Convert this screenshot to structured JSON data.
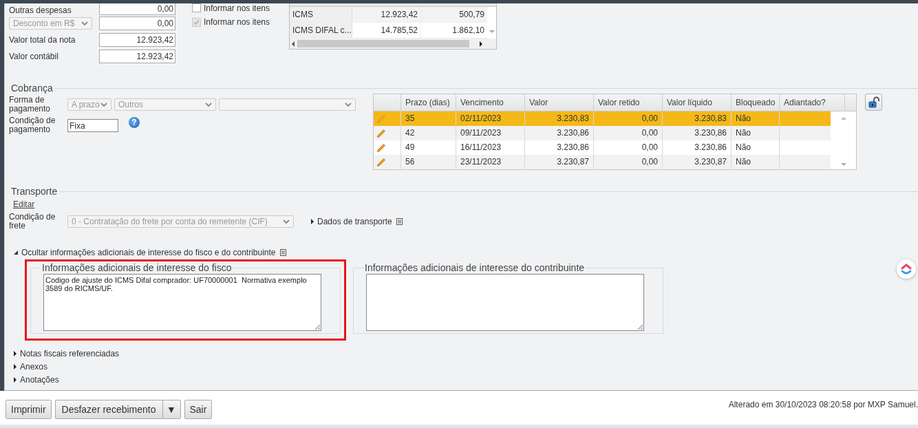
{
  "charges_summary": [
    {
      "kind": "field",
      "label": "Outras despesas",
      "value": "0,00"
    },
    {
      "kind": "select",
      "label": "Desconto em R$",
      "value": "0,00"
    },
    {
      "kind": "field",
      "label": "Valor total da nota",
      "value": "12.923,42"
    },
    {
      "kind": "field",
      "label": "Valor contábil",
      "value": "12.923,42"
    }
  ],
  "item_options": [
    {
      "label": "Informar nos itens",
      "checked": false
    },
    {
      "label": "Informar nos itens",
      "checked": true
    }
  ],
  "tax_table": {
    "rows": [
      {
        "cells": [
          "ICMS",
          "12.923,42",
          "500,79"
        ]
      },
      {
        "cells": [
          "ICMS DIFAL c...",
          "14.785,52",
          "1.862,10"
        ]
      }
    ]
  },
  "cobranca": {
    "title": "Cobrança",
    "payment_form": {
      "label": "Forma de pagamento",
      "selects": [
        {
          "kind": "value",
          "value": "A prazo"
        },
        {
          "kind": "value",
          "value": "Outros"
        },
        {
          "kind": "empty"
        }
      ]
    },
    "payment_condition": {
      "label": "Condição de pagamento",
      "value": "Fixa",
      "help": "?"
    },
    "installments": {
      "columns": [
        "Prazo (dias)",
        "Vencimento",
        "Valor",
        "Valor retido",
        "Valor líquido",
        "Bloqueado",
        "Adiantado?"
      ],
      "rows": [
        {
          "selected": true,
          "cells": [
            "35",
            "02/11/2023",
            "3.230,83",
            "0,00",
            "3.230,83",
            "Não"
          ]
        },
        {
          "selected": false,
          "cells": [
            "42",
            "09/11/2023",
            "3.230,86",
            "0,00",
            "3.230,86",
            "Não"
          ]
        },
        {
          "selected": false,
          "cells": [
            "49",
            "16/11/2023",
            "3.230,86",
            "0,00",
            "3.230,86",
            "Não"
          ]
        },
        {
          "selected": false,
          "cells": [
            "56",
            "23/11/2023",
            "3.230,87",
            "0,00",
            "3.230,87",
            "Não"
          ]
        }
      ]
    }
  },
  "transporte": {
    "title": "Transporte",
    "edit_link": "Editar",
    "freight": {
      "label": "Condição de frete",
      "value": "0 - Contratação do frete por conta do remetente (CIF)"
    },
    "details_toggle": {
      "label": "Dados de transporte",
      "expanded": false
    }
  },
  "additional_info": {
    "toggle": {
      "label": "Ocultar informações adicionais de interesse do fisco e do contribuinte",
      "expanded": true
    },
    "panels": [
      {
        "title": "Informações adicionais de interesse do fisco",
        "value": "Codigo de ajuste do ICMS Difal comprador: UF70000001  Normativa exemplo 3589 do RICMS/UF.",
        "highlighted": true
      },
      {
        "title": "Informações adicionais de interesse do contribuinte",
        "highlighted": false
      }
    ]
  },
  "sections": [
    {
      "label": "Notas fiscais referenciadas",
      "expanded": false
    },
    {
      "label": "Anexos",
      "expanded": false
    },
    {
      "label": "Anotações",
      "expanded": false
    }
  ],
  "footer": {
    "buttons": [
      {
        "kind": "plain",
        "label": "Imprimir"
      },
      {
        "kind": "split",
        "label": "Desfazer recebimento",
        "menu": "▼"
      },
      {
        "kind": "plain",
        "label": "Sair"
      }
    ],
    "status": "Alterado em 30/10/2023 08:20:58 por MXP Samuel."
  }
}
